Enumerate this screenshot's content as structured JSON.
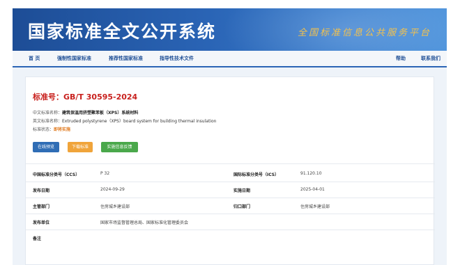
{
  "header": {
    "title": "国家标准全文公开系统",
    "slogan": "全国标准信息公共服务平台"
  },
  "nav": {
    "items": [
      "首 页",
      "强制性国家标准",
      "推荐性国家标准",
      "指导性技术文件"
    ],
    "help": "帮助",
    "contact": "联系我们"
  },
  "standard": {
    "number_label": "标准号：",
    "number": "GB/T 30595-2024",
    "cn_name_label": "中文标准名称：",
    "cn_name": "建筑保温用挤塑聚苯板（XPS）系统材料",
    "en_name_label": "英文标准名称：",
    "en_name": "Extruded polystyrene（XPS）board system for building thermal insulation",
    "status_label": "标准状态：",
    "status": "即将实施"
  },
  "buttons": {
    "preview": "在线预览",
    "download": "下载标准",
    "feedback": "实施信息反馈"
  },
  "details": {
    "ccs_label": "中国标准分类号（CCS）",
    "ccs": "P 32",
    "ics_label": "国际标准分类号（ICS）",
    "ics": "91.120.10",
    "publish_label": "发布日期",
    "publish_date": "2024-09-29",
    "implement_label": "实施日期",
    "implement_date": "2025-04-01",
    "dept_label": "主管部门",
    "dept": "住房城乡建设部",
    "centralized_label": "归口部门",
    "centralized": "住房城乡建设部",
    "issuer_label": "发布单位",
    "issuer": "国家市场监督管理总局、国家标准化管理委员会",
    "remark_label": "备注",
    "remark": ""
  }
}
